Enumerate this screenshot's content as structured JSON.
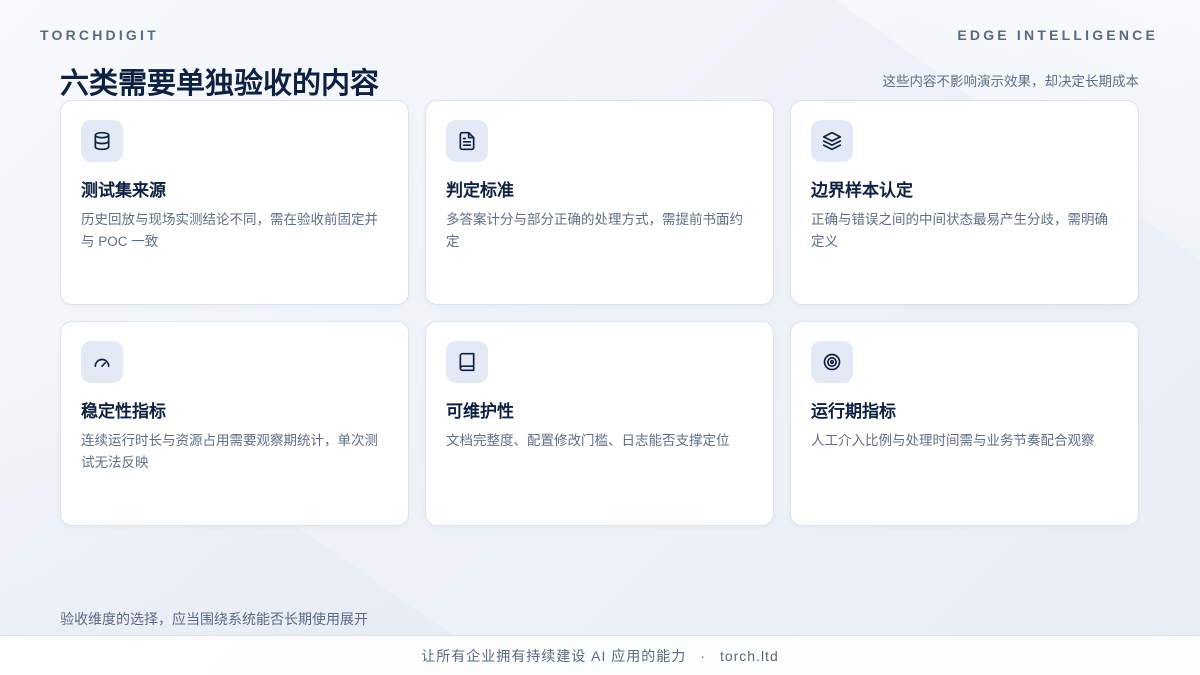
{
  "brand": {
    "left": "TORCHDIGIT",
    "right": "EDGE INTELLIGENCE"
  },
  "header": {
    "title": "六类需要单独验收的内容",
    "subtitle": "这些内容不影响演示效果，却决定长期成本"
  },
  "cards": [
    {
      "icon": "database-icon",
      "title": "测试集来源",
      "desc": "历史回放与现场实测结论不同，需在验收前固定并与 POC 一致"
    },
    {
      "icon": "document-icon",
      "title": "判定标准",
      "desc": "多答案计分与部分正确的处理方式，需提前书面约定"
    },
    {
      "icon": "layers-icon",
      "title": "边界样本认定",
      "desc": "正确与错误之间的中间状态最易产生分歧，需明确定义"
    },
    {
      "icon": "gauge-icon",
      "title": "稳定性指标",
      "desc": "连续运行时长与资源占用需要观察期统计，单次测试无法反映"
    },
    {
      "icon": "book-icon",
      "title": "可维护性",
      "desc": "文档完整度、配置修改门槛、日志能否支撑定位"
    },
    {
      "icon": "target-icon",
      "title": "运行期指标",
      "desc": "人工介入比例与处理时间需与业务节奏配合观察"
    }
  ],
  "footer": {
    "note": "验收维度的选择，应当围绕系统能否长期使用展开",
    "slogan": "让所有企业拥有持续建设 AI 应用的能力",
    "separator": "·",
    "site": "torch.ltd"
  },
  "colors": {
    "accent": "#0f2140",
    "icon_bg": "#e3eaf5",
    "muted_text": "#5f6f86"
  }
}
